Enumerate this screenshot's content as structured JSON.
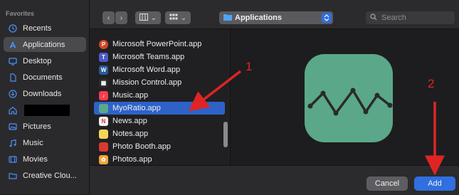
{
  "sidebar": {
    "section_title": "Favorites",
    "items": [
      {
        "label": "Recents",
        "icon": "clock-icon"
      },
      {
        "label": "Applications",
        "icon": "applications-icon",
        "active": true
      },
      {
        "label": "Desktop",
        "icon": "desktop-icon"
      },
      {
        "label": "Documents",
        "icon": "document-icon"
      },
      {
        "label": "Downloads",
        "icon": "download-icon"
      },
      {
        "label": "",
        "icon": "home-icon",
        "redacted": true
      },
      {
        "label": "Pictures",
        "icon": "pictures-icon"
      },
      {
        "label": "Music",
        "icon": "music-note-icon"
      },
      {
        "label": "Movies",
        "icon": "movies-icon"
      },
      {
        "label": "Creative Clou...",
        "icon": "folder-icon"
      }
    ]
  },
  "toolbar": {
    "location": "Applications",
    "search_placeholder": "Search"
  },
  "files": [
    {
      "label": "Microsoft PowerPoint.app",
      "color": "#d24726",
      "glyph": "P"
    },
    {
      "label": "Microsoft Teams.app",
      "color": "#5059c9",
      "glyph": "T"
    },
    {
      "label": "Microsoft Word.app",
      "color": "#2b579a",
      "glyph": "W"
    },
    {
      "label": "Mission Control.app",
      "color": "#2a2a2a",
      "glyph": "▦"
    },
    {
      "label": "Music.app",
      "color": "#fa3c4c",
      "glyph": "♪"
    },
    {
      "label": "MyoRatio.app",
      "color": "#5aa889",
      "glyph": "",
      "selected": true
    },
    {
      "label": "News.app",
      "color": "#f0f0f0",
      "glyph": "N"
    },
    {
      "label": "Notes.app",
      "color": "#f5d65a",
      "glyph": ""
    },
    {
      "label": "Photo Booth.app",
      "color": "#d63b2f",
      "glyph": ""
    },
    {
      "label": "Photos.app",
      "color": "#f2a33a",
      "glyph": "✿"
    }
  ],
  "footer": {
    "cancel_label": "Cancel",
    "add_label": "Add"
  },
  "annotations": {
    "step1": "1",
    "step2": "2"
  },
  "colors": {
    "accent": "#2f6fe0",
    "selection": "#2e62c9",
    "annotation": "#e02424",
    "app_icon_bg": "#5aa889"
  }
}
